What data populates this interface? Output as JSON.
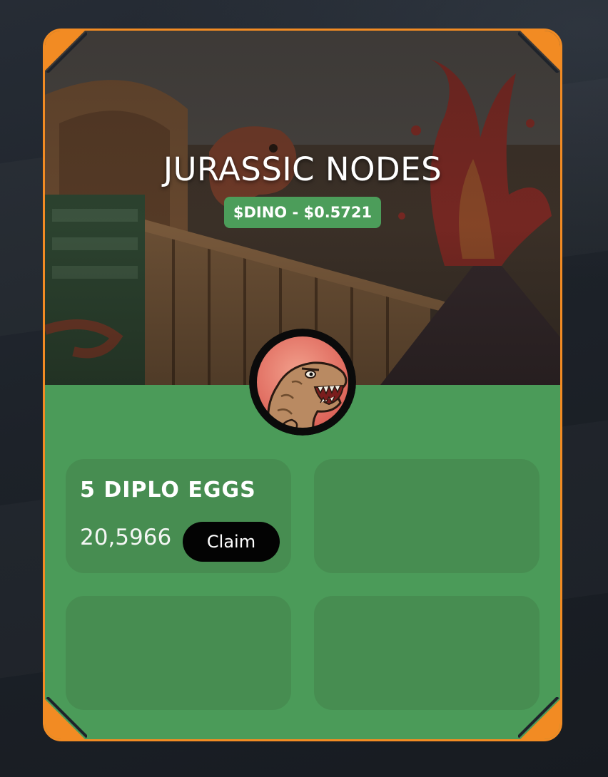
{
  "app": {
    "title": "JURASSIC NODES",
    "price_badge": "$DINO - $0.5721"
  },
  "colors": {
    "accent_border": "#f28b23",
    "panel_green": "#4b9b59",
    "tile_green": "#478d51",
    "badge_green": "#4c9d5a",
    "claim_button": "#030303",
    "page_background": "#1e232b"
  },
  "icons": {
    "hero": "jurassic-park-illustration",
    "avatar": "t-rex-avatar-icon"
  },
  "nodes": [
    {
      "title": "5 DIPLO EGGS",
      "amount": "20,5966",
      "action_label": "Claim"
    }
  ]
}
